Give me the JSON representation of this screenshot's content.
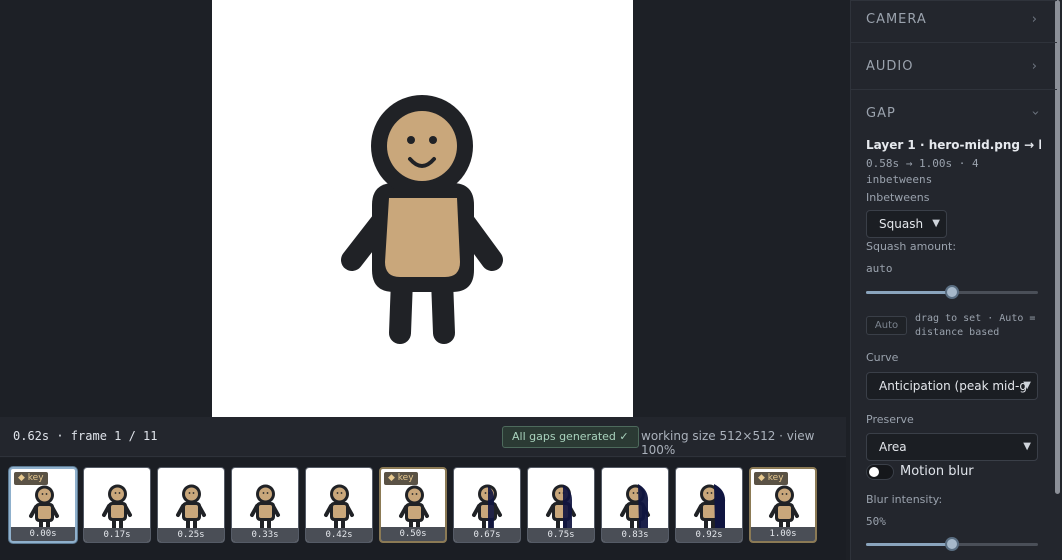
{
  "status": {
    "time_label": "0.62s · frame 1 / 11",
    "gaps_badge": "All gaps generated ✓",
    "working_info": "working size 512×512 · view 100%"
  },
  "frames": [
    {
      "time": "0.00s",
      "key": true,
      "active": true,
      "pose": "base"
    },
    {
      "time": "0.17s",
      "key": false,
      "active": false,
      "pose": "base"
    },
    {
      "time": "0.25s",
      "key": false,
      "active": false,
      "pose": "base"
    },
    {
      "time": "0.33s",
      "key": false,
      "active": false,
      "pose": "base"
    },
    {
      "time": "0.42s",
      "key": false,
      "active": false,
      "pose": "base"
    },
    {
      "time": "0.50s",
      "key": true,
      "active": false,
      "pose": "base"
    },
    {
      "time": "0.67s",
      "key": false,
      "active": false,
      "pose": "turn1"
    },
    {
      "time": "0.75s",
      "key": false,
      "active": false,
      "pose": "turn2"
    },
    {
      "time": "0.83s",
      "key": false,
      "active": false,
      "pose": "turn3"
    },
    {
      "time": "0.92s",
      "key": false,
      "active": false,
      "pose": "turn4"
    },
    {
      "time": "1.00s",
      "key": true,
      "active": false,
      "pose": "base"
    }
  ],
  "key_tag": "◆ key",
  "panel": {
    "sections": [
      {
        "label": "CAMERA",
        "expanded": false
      },
      {
        "label": "AUDIO",
        "expanded": false
      },
      {
        "label": "GAP",
        "expanded": true
      }
    ],
    "gap": {
      "layer_title": "Layer 1 · hero-mid.png → h...",
      "range_line1": "0.58s → 1.00s · 4",
      "range_line2": "inbetweens",
      "inbetweens_label": "Inbetweens",
      "inbetweens_value": "Squash",
      "squash_label": "Squash amount:",
      "squash_value": "auto",
      "squash_fraction": 0.5,
      "auto_button": "Auto",
      "hint_text": "drag to set · Auto = distance based",
      "curve_label": "Curve",
      "curve_value": "Anticipation (peak mid-g",
      "preserve_label": "Preserve",
      "preserve_value": "Area",
      "motion_blur_label": "Motion blur",
      "motion_blur_on": false,
      "blur_label": "Blur intensity:",
      "blur_value": "50%",
      "blur_fraction": 0.5
    }
  },
  "colors": {
    "skin": "#c9a77b",
    "outline": "#202226",
    "shadow_figure": "#101540",
    "accent": "#8aa4bd"
  },
  "icons": {
    "collapsed": "chevron-right-icon",
    "expanded": "chevron-down-icon",
    "dropdown": "caret-down-icon"
  }
}
